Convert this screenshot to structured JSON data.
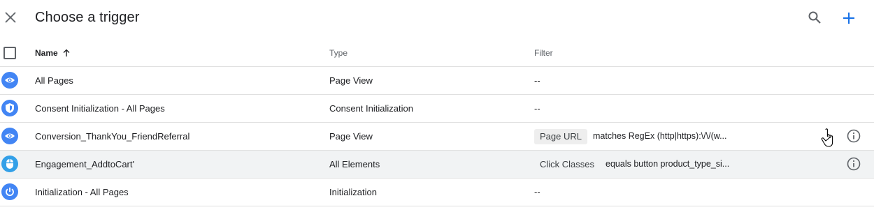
{
  "header": {
    "title": "Choose a trigger",
    "close_icon": "close-icon",
    "search_icon": "search-icon",
    "add_icon": "plus-icon"
  },
  "table": {
    "columns": {
      "name": "Name",
      "type": "Type",
      "filter": "Filter"
    },
    "sort": "ascending",
    "rows": [
      {
        "icon": "eye-icon",
        "name": "All Pages",
        "type": "Page View",
        "filter_text": "--"
      },
      {
        "icon": "shield-icon",
        "name": "Consent Initialization - All Pages",
        "type": "Consent Initialization",
        "filter_text": "--"
      },
      {
        "icon": "eye-icon",
        "name": "Conversion_ThankYou_FriendReferral",
        "type": "Page View",
        "filter_variable": "Page URL",
        "filter_condition": "matches RegEx (http|https):\\/\\/(w..."
      },
      {
        "icon": "mouse-icon",
        "name": "Engagement_AddtoCart'",
        "type": "All Elements",
        "filter_variable": "Click Classes",
        "filter_condition": "equals button product_type_si..."
      },
      {
        "icon": "power-icon",
        "name": "Initialization - All Pages",
        "type": "Initialization",
        "filter_text": "--"
      }
    ]
  },
  "colors": {
    "accent": "#1a73e8",
    "icon_blue": "#4285f4",
    "icon_teal": "#33a0e8",
    "divider": "#e0e0e0",
    "hover_row": "#f1f3f4"
  }
}
